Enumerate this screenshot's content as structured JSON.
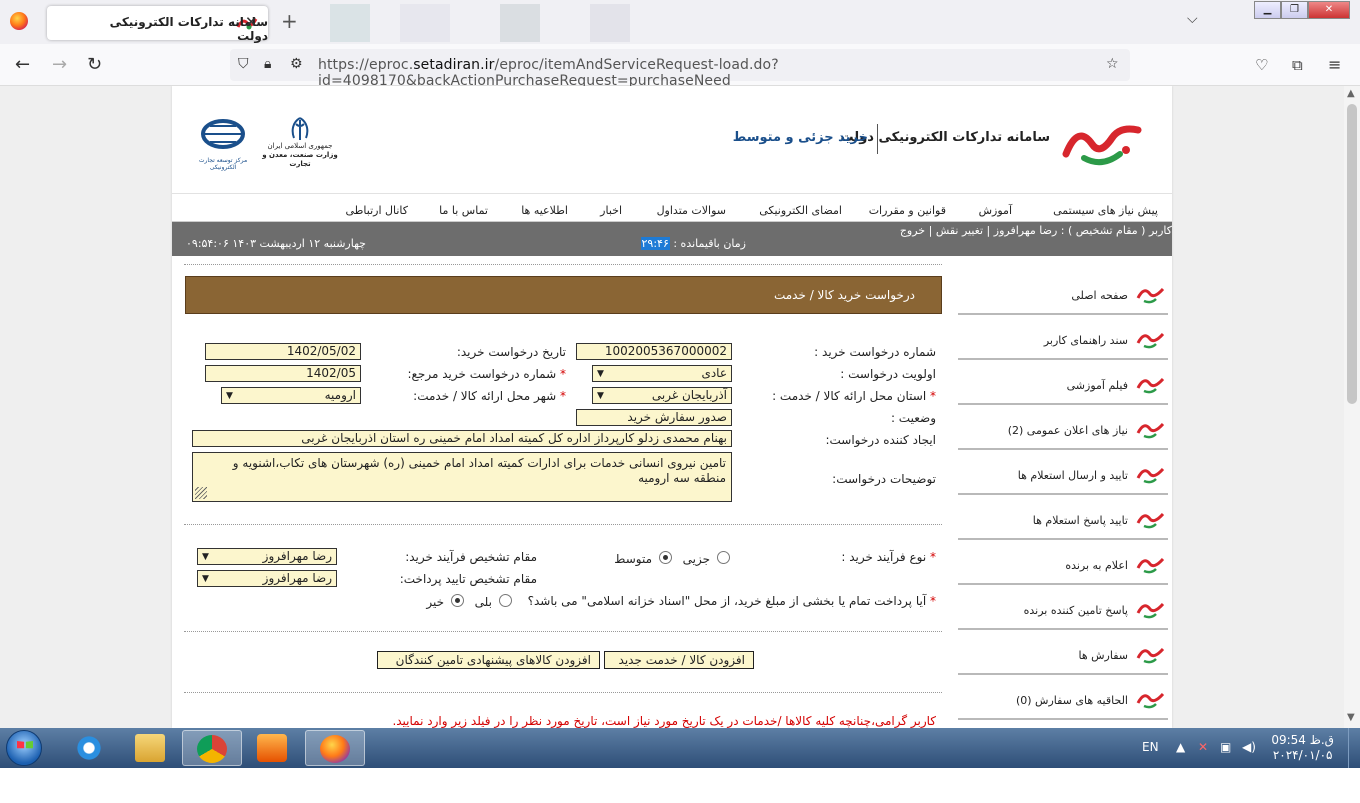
{
  "browser": {
    "tab_title": "سامانه تدارکات الکترونیکی دولت",
    "tab_close": "✕",
    "new_tab": "+",
    "url_host": "setadiran.ir",
    "url_prefix": "https://eproc.",
    "url_rest": "/eproc/itemAndServiceRequest-load.do?id=4098170&backActionPurchaseRequest=purchaseNeed",
    "win_controls": [
      "▁",
      "❐",
      "✕"
    ]
  },
  "header": {
    "site_name": "سامانه تدارکات الکترونیکی دولت",
    "subtitle": "خرید جزئی و متوسط",
    "emblem_caption_1": "جمهوری اسلامی ایران",
    "emblem_caption_2": "وزارت صنعت، معدن و تجارت",
    "ecommerce_caption": "مرکز توسعه تجارت الکترونیکی",
    "brand_color": "#d7262d",
    "brand_green": "#2c9a48"
  },
  "menu": {
    "items": [
      "پیش نیاز های سیستمی",
      "آموزش",
      "قوانین و مقررات",
      "امضای الکترونیکی",
      "سوالات متداول",
      "اخبار",
      "اطلاعیه ها",
      "تماس با ما",
      "کانال ارتباطی"
    ]
  },
  "userbar": {
    "user_text": "کاربر ( مقام تشخیص ) : رضا مهرافروز",
    "change_role": "تغییر نقش",
    "logout": "خروج",
    "timer_label": "زمان باقیمانده :",
    "timer_value": "۲۹:۴۶",
    "datetime": "چهارشنبه ۱۲ اردیبهشت ۱۴۰۳   ۰۹:۵۴:۰۶"
  },
  "form": {
    "title": "درخواست خرید کالا / خدمت",
    "request_number_label": "شماره درخواست خرید :",
    "request_number": "1002005367000002",
    "request_date_label": "تاریخ درخواست خرید:",
    "request_date": "1402/05/02",
    "priority_label": "اولویت درخواست :",
    "priority": "عادی",
    "ref_number_label": "شماره درخواست خرید مرجع:",
    "ref_number": "1402/05",
    "province_label": "استان محل ارائه کالا / خدمت :",
    "province": "آذربایجان غربی",
    "city_label": "شهر محل ارائه کالا / خدمت:",
    "city": "ارومیه",
    "status_label": "وضعیت :",
    "status": "صدور سفارش خرید",
    "creator_label": "ایجاد کننده درخواست:",
    "creator": "بهنام محمدی زدلو کارپرداز اداره کل کمیته امداد امام خمینی  ره  استان اذربایجان غربی",
    "description_label": "توضیحات درخواست:",
    "description": "تامین نیروی انسانی خدمات برای ادارات کمیته امداد امام خمینی (ره) شهرستان های تکاب،اشنویه و منطقه سه ارومیه",
    "process_type_label": "نوع فرآیند خرید :",
    "process_minor": "جزیی",
    "process_medium": "متوسط",
    "process_selected": "medium",
    "purchase_authority_label": "مقام تشخیص فرآیند خرید:",
    "purchase_authority": "رضا مهرافروز",
    "payment_authority_label": "مقام تشخیص تایید پرداخت:",
    "payment_authority": "رضا مهرافروز",
    "treasury_question": "آیا پرداخت تمام یا بخشی از مبلغ خرید، از محل \"اسناد خزانه اسلامی\" می باشد؟",
    "yes": "بلی",
    "no": "خیر",
    "treasury_selected": "no",
    "add_item_button": "افزودن کالا / خدمت جدید",
    "add_suggested_button": "افزودن کالاهای پیشنهادی تامین کنندگان",
    "notice": "کاربر گرامی،چنانچه کلیه کالاها /خدمات در یک تاریخ مورد نیاز است، تاریخ مورد نظر را در فیلد زیر وارد نمایید.",
    "required_mark": "*"
  },
  "sidebar": {
    "items": [
      "صفحه اصلی",
      "سند راهنمای کاربر",
      "فیلم آموزشی",
      "نیاز های اعلان عمومی (2)",
      "تایید و ارسال استعلام ها",
      "تایید پاسخ استعلام ها",
      "اعلام به برنده",
      "پاسخ تامین کننده برنده",
      "سفارش ها",
      "الحاقیه های سفارش (0)"
    ]
  },
  "taskbar": {
    "lang": "EN",
    "time": "09:54 ق.ظ",
    "date": "۲۰۲۴/۰۱/۰۵",
    "apps": [
      "ie-icon",
      "explorer-icon",
      "chrome-icon",
      "media-player-icon",
      "firefox-icon"
    ]
  }
}
